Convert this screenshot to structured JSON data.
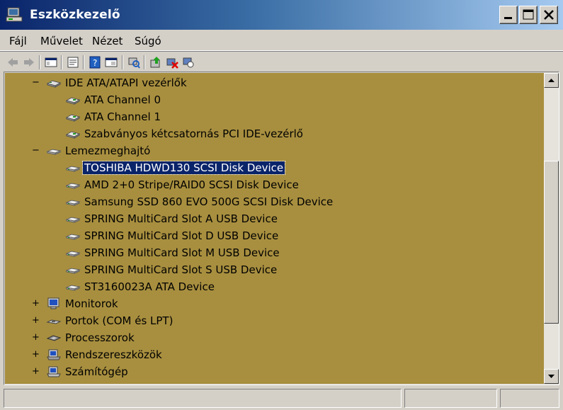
{
  "window": {
    "title": "Eszközkezelő"
  },
  "menu": {
    "items": [
      "Fájl",
      "Művelet",
      "Nézet",
      "Súgó"
    ]
  },
  "toolbar": {
    "tools": [
      "back-icon",
      "forward-icon",
      "console-tree-icon",
      "properties-icon",
      "help-icon",
      "view-icon",
      "scan-hardware-icon",
      "update-driver-icon",
      "uninstall-icon",
      "disable-icon"
    ]
  },
  "tree": {
    "nodes": [
      {
        "label": "IDE ATA/ATAPI vezérlők",
        "level": 0,
        "expanded": true,
        "icon": "ide-controller-icon"
      },
      {
        "label": "ATA Channel 0",
        "level": 1,
        "icon": "ide-channel-icon"
      },
      {
        "label": "ATA Channel 1",
        "level": 1,
        "icon": "ide-channel-icon"
      },
      {
        "label": "Szabványos kétcsatornás PCI IDE-vezérlő",
        "level": 1,
        "icon": "ide-channel-icon"
      },
      {
        "label": "Lemezmeghajtó",
        "level": 0,
        "expanded": true,
        "icon": "disk-drive-icon"
      },
      {
        "label": "TOSHIBA HDWD130 SCSI Disk Device",
        "level": 1,
        "icon": "disk-icon",
        "selected": true
      },
      {
        "label": "AMD 2+0 Stripe/RAID0 SCSI Disk Device",
        "level": 1,
        "icon": "disk-icon"
      },
      {
        "label": "Samsung SSD 860 EVO 500G SCSI Disk Device",
        "level": 1,
        "icon": "disk-icon"
      },
      {
        "label": "SPRING MultiCard Slot A USB Device",
        "level": 1,
        "icon": "disk-icon"
      },
      {
        "label": "SPRING MultiCard Slot D USB Device",
        "level": 1,
        "icon": "disk-icon"
      },
      {
        "label": "SPRING MultiCard Slot M USB Device",
        "level": 1,
        "icon": "disk-icon"
      },
      {
        "label": "SPRING MultiCard Slot S USB Device",
        "level": 1,
        "icon": "disk-icon"
      },
      {
        "label": "ST3160023A ATA Device",
        "level": 1,
        "icon": "disk-icon"
      },
      {
        "label": "Monitorok",
        "level": 0,
        "expanded": false,
        "icon": "monitor-icon"
      },
      {
        "label": "Portok (COM és LPT)",
        "level": 0,
        "expanded": false,
        "icon": "port-icon"
      },
      {
        "label": "Processzorok",
        "level": 0,
        "expanded": false,
        "icon": "processor-icon"
      },
      {
        "label": "Rendszereszközök",
        "level": 0,
        "expanded": false,
        "icon": "system-devices-icon"
      },
      {
        "label": "Számítógép",
        "level": 0,
        "expanded": false,
        "icon": "computer-icon"
      }
    ]
  },
  "colors": {
    "tree_background": "#a88f3f",
    "selection": "#0a246a",
    "title_start": "#0a246a",
    "title_end": "#a6caf0"
  }
}
